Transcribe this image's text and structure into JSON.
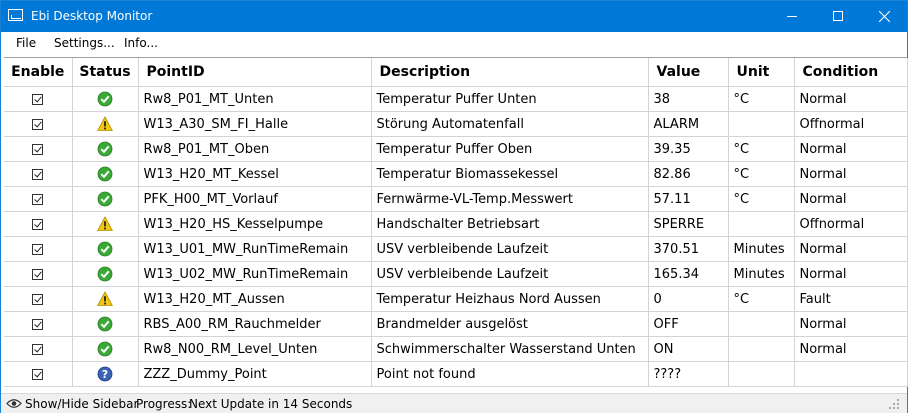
{
  "window": {
    "title": "Ebi Desktop Monitor"
  },
  "menu": {
    "file": "File",
    "settings": "Settings...",
    "info": "Info..."
  },
  "columns": {
    "enable": "Enable",
    "status": "Status",
    "point_id": "PointID",
    "description": "Description",
    "value": "Value",
    "unit": "Unit",
    "condition": "Condition"
  },
  "rows": [
    {
      "enabled": true,
      "status": "ok",
      "point_id": "Rw8_P01_MT_Unten",
      "description": "Temperatur Puffer Unten",
      "value": "38",
      "unit": "°C",
      "condition": "Normal"
    },
    {
      "enabled": true,
      "status": "warning",
      "point_id": "W13_A30_SM_FI_Halle",
      "description": "Störung Automatenfall",
      "value": "ALARM",
      "unit": "",
      "condition": "Offnormal"
    },
    {
      "enabled": true,
      "status": "ok",
      "point_id": "Rw8_P01_MT_Oben",
      "description": "Temperatur Puffer Oben",
      "value": "39.35",
      "unit": "°C",
      "condition": "Normal"
    },
    {
      "enabled": true,
      "status": "ok",
      "point_id": "W13_H20_MT_Kessel",
      "description": "Temperatur Biomassekessel",
      "value": "82.86",
      "unit": "°C",
      "condition": "Normal"
    },
    {
      "enabled": true,
      "status": "ok",
      "point_id": "PFK_H00_MT_Vorlauf",
      "description": "Fernwärme-VL-Temp.Messwert",
      "value": "57.11",
      "unit": "°C",
      "condition": "Normal"
    },
    {
      "enabled": true,
      "status": "warning",
      "point_id": "W13_H20_HS_Kesselpumpe",
      "description": "Handschalter Betriebsart",
      "value": "SPERRE",
      "unit": "",
      "condition": "Offnormal"
    },
    {
      "enabled": true,
      "status": "ok",
      "point_id": "W13_U01_MW_RunTimeRemain",
      "description": "USV verbleibende Laufzeit",
      "value": "370.51",
      "unit": "Minutes",
      "condition": "Normal"
    },
    {
      "enabled": true,
      "status": "ok",
      "point_id": "W13_U02_MW_RunTimeRemain",
      "description": "USV verbleibende Laufzeit",
      "value": "165.34",
      "unit": "Minutes",
      "condition": "Normal"
    },
    {
      "enabled": true,
      "status": "warning",
      "point_id": "W13_H20_MT_Aussen",
      "description": "Temperatur Heizhaus Nord Aussen",
      "value": "0",
      "unit": "°C",
      "condition": "Fault"
    },
    {
      "enabled": true,
      "status": "ok",
      "point_id": "RBS_A00_RM_Rauchmelder",
      "description": "Brandmelder ausgelöst",
      "value": "OFF",
      "unit": "",
      "condition": "Normal"
    },
    {
      "enabled": true,
      "status": "ok",
      "point_id": "Rw8_N00_RM_Level_Unten",
      "description": "Schwimmerschalter Wasserstand Unten",
      "value": "ON",
      "unit": "",
      "condition": "Normal"
    },
    {
      "enabled": true,
      "status": "unknown",
      "point_id": "ZZZ_Dummy_Point",
      "description": "Point not found",
      "value": "????",
      "unit": "",
      "condition": ""
    }
  ],
  "statusbar": {
    "sidebar_toggle": "Show/Hide Sidebar",
    "progress_label": "Progress:",
    "update_text": "Next Update in 14 Seconds"
  },
  "colors": {
    "titlebar": "#0078d7",
    "ok": "#3aa935",
    "warning": "#f2c811",
    "unknown": "#3b63b5"
  }
}
